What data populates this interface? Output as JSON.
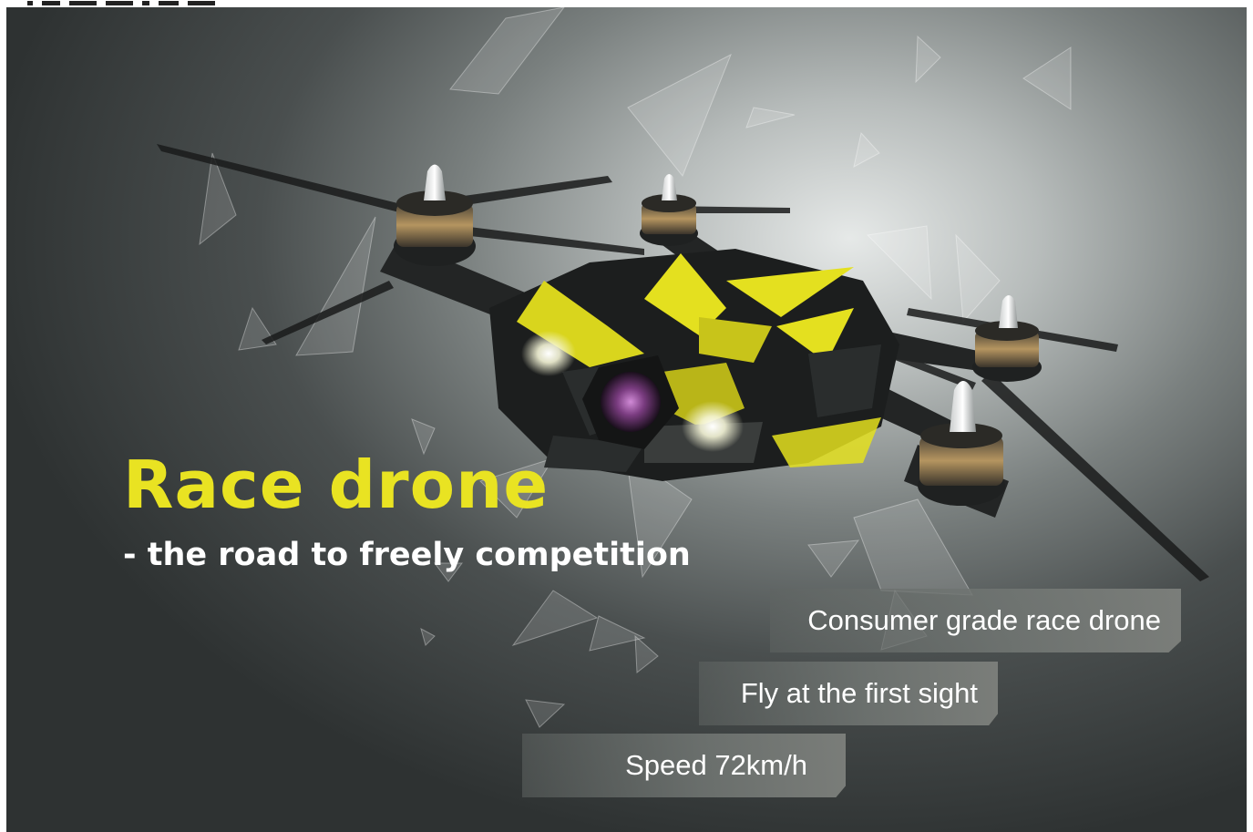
{
  "banner": {
    "headline": "Race drone",
    "subheadline": "- the road to freely competition",
    "features": [
      "Consumer grade race drone",
      "Fly at the first sight",
      "Speed 72km/h"
    ]
  },
  "colors": {
    "headline": "#e9e322",
    "subheadline": "#ffffff",
    "drone_accent": "#e4e01f",
    "drone_body": "#1c1e1e",
    "background_dark": "#2e3232",
    "background_light": "#e6e9e8"
  }
}
